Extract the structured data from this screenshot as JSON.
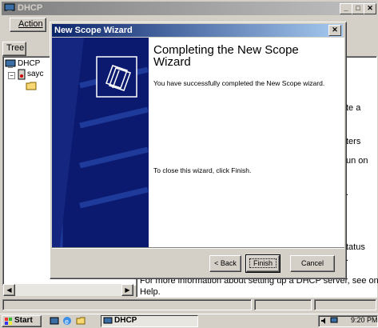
{
  "main_window": {
    "title": "DHCP",
    "menu_action": "Action",
    "tab_tree": "Tree",
    "tree_root": "DHCP",
    "tree_server": "sayc",
    "right_text_fragments": [
      "te a",
      "ters",
      "un on",
      ".",
      "tatus",
      "."
    ],
    "help_line1": "For more information about setting up a DHCP server, see online",
    "help_line2": "Help."
  },
  "wizard": {
    "title": "New Scope Wizard",
    "heading": "Completing the New Scope Wizard",
    "success_text": "You have successfully completed the New Scope wizard.",
    "close_text": "To close this wizard, click Finish.",
    "back_button": "< Back",
    "finish_button": "Finish",
    "cancel_button": "Cancel",
    "close_glyph": "✕"
  },
  "taskbar": {
    "start_label": "Start",
    "task_label": "DHCP",
    "clock": "9:20 PM"
  },
  "colors": {
    "title_active": "#0a246a",
    "title_inactive": "#808080",
    "wizard_banner": "#0b1a6e"
  }
}
